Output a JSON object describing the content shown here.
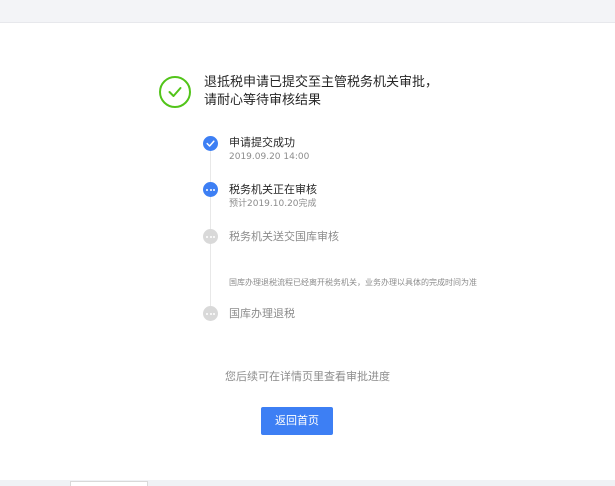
{
  "result": {
    "title_line1": "退抵税申请已提交至主管税务机关审批，",
    "title_line2": "请耐心等待审核结果",
    "status_icon": "check-circle-icon",
    "status_color": "#52c41a"
  },
  "timeline": {
    "steps": [
      {
        "title": "申请提交成功",
        "subtitle": "2019.09.20  14:00",
        "status": "done"
      },
      {
        "title": "税务机关正在审核",
        "subtitle": "预计2019.10.20完成",
        "status": "active"
      },
      {
        "title": "税务机关送交国库审核",
        "status": "pending"
      },
      {
        "title": "国库办理退税",
        "status": "pending"
      }
    ],
    "note": "国库办理退税流程已经离开税务机关，业务办理以具体的完成时间为准"
  },
  "footer": {
    "hint": "您后续可在详情页里查看审批进度",
    "back_button": "返回首页"
  },
  "colors": {
    "primary": "#3d7ff4",
    "pending": "#d9d9d9",
    "success": "#52c41a"
  }
}
